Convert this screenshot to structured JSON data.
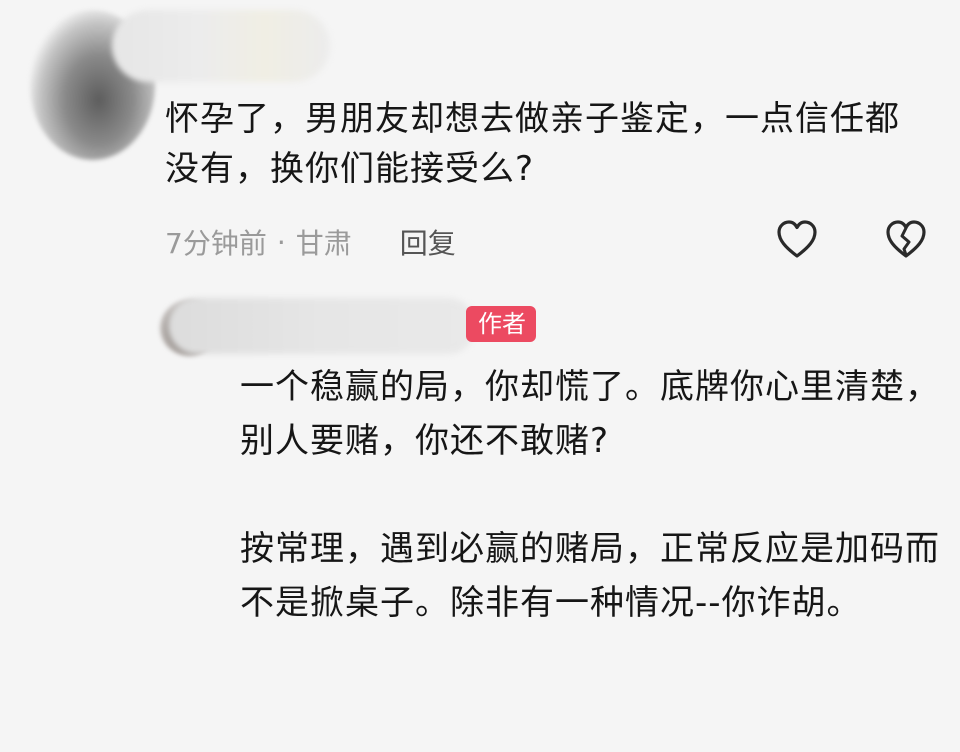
{
  "comment": {
    "text": "怀孕了，男朋友却想去做亲子鉴定，一点信任都没有，换你们能接受么?",
    "time": "7分钟前",
    "separator": "·",
    "location": "甘肃",
    "reply_label": "回复",
    "icons": [
      "heart-icon",
      "broken-heart-icon"
    ]
  },
  "reply": {
    "badge": "作者",
    "paragraph1": "一个稳赢的局，你却慌了。底牌你心里清楚，别人要赌，你还不敢赌?",
    "paragraph2": "按常理，遇到必赢的赌局，正常反应是加码而不是掀桌子。除非有一种情况--你诈胡。"
  },
  "colors": {
    "background": "#f5f5f5",
    "text": "#161616",
    "meta": "#9a9a9a",
    "badge": "#ec4a61"
  }
}
